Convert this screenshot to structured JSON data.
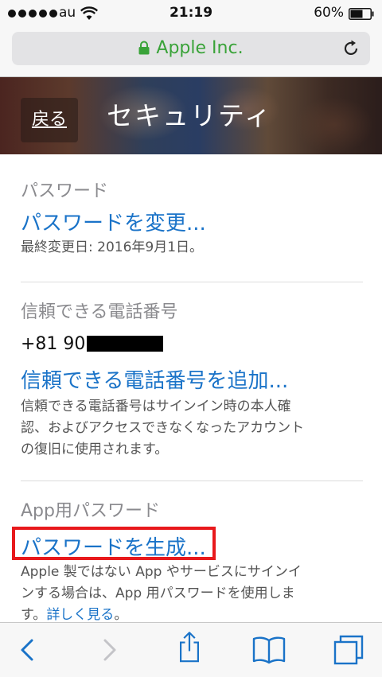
{
  "status_bar": {
    "carrier": "au",
    "time": "21:19",
    "battery": "60%",
    "battery_level": 0.6
  },
  "url_bar": {
    "domain": "Apple Inc."
  },
  "header": {
    "back_label": "戻る",
    "title": "セキュリティ"
  },
  "password_section": {
    "title": "パスワード",
    "change_link": "パスワードを変更...",
    "last_changed": "最終変更日: 2016年9月1日。"
  },
  "phone_section": {
    "title": "信頼できる電話番号",
    "number_prefix": "+81 90",
    "add_link": "信頼できる電話番号を追加...",
    "note_line1": "信頼できる電話番号はサインイン時の本人確",
    "note_line2": "認、およびアクセスできなくなったアカウント",
    "note_line3": "の復旧に使用されます。"
  },
  "app_password_section": {
    "title": "App用パスワード",
    "generate_link": "パスワードを生成...",
    "note_line1": "Apple 製ではない App やサービスにサインイ",
    "note_line2": "ンする場合は、App 用パスワードを使用しま",
    "note_line3_prefix": "す。",
    "learn_more": "詳しく見る",
    "note_line3_suffix": "。"
  },
  "colors": {
    "link": "#1a73c8",
    "secure_green": "#3aa339",
    "highlight": "#e8191c"
  },
  "toolbar": {
    "icons": [
      "chevron-left-icon",
      "chevron-right-icon",
      "share-icon",
      "bookmarks-icon",
      "tabs-icon"
    ]
  }
}
